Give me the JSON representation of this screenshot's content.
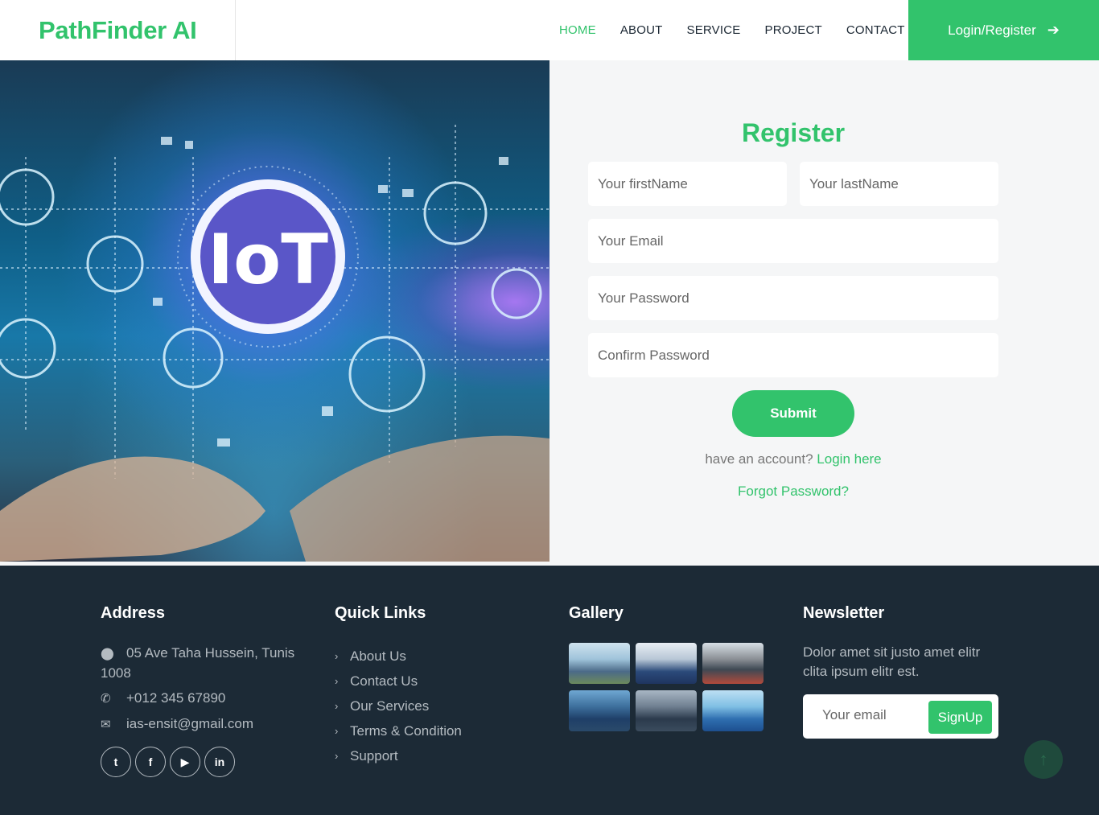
{
  "brand": {
    "name": "PathFinder AI"
  },
  "nav": {
    "items": [
      "HOME",
      "ABOUT",
      "SERVICE",
      "PROJECT",
      "CONTACT"
    ],
    "active": "HOME",
    "login_label": "Login/Register",
    "login_icon": "arrow-right-icon"
  },
  "hero": {
    "image_text": "IoT"
  },
  "register": {
    "title": "Register",
    "fields": {
      "first_name": "Your firstName",
      "last_name": "Your lastName",
      "email": "Your Email",
      "password": "Your Password",
      "confirm_password": "Confirm Password"
    },
    "submit_label": "Submit",
    "have_account_text": "have an account?",
    "login_link": "Login here",
    "forgot_link": "Forgot Password?"
  },
  "footer": {
    "address": {
      "title": "Address",
      "street": "05 Ave Taha Hussein, Tunis 1008",
      "phone": "+012 345 67890",
      "email": "ias-ensit@gmail.com",
      "socials": [
        "twitter-icon",
        "facebook-icon",
        "youtube-icon",
        "linkedin-icon"
      ]
    },
    "quick_links": {
      "title": "Quick Links",
      "items": [
        "About Us",
        "Contact Us",
        "Our Services",
        "Terms & Condition",
        "Support"
      ]
    },
    "gallery": {
      "title": "Gallery"
    },
    "newsletter": {
      "title": "Newsletter",
      "text": "Dolor amet sit justo amet elitr clita ipsum elitr est.",
      "placeholder": "Your email",
      "button": "SignUp"
    }
  },
  "colors": {
    "accent": "#32c36c",
    "footer_bg": "#1c2a36",
    "panel_bg": "#f5f6f7"
  }
}
